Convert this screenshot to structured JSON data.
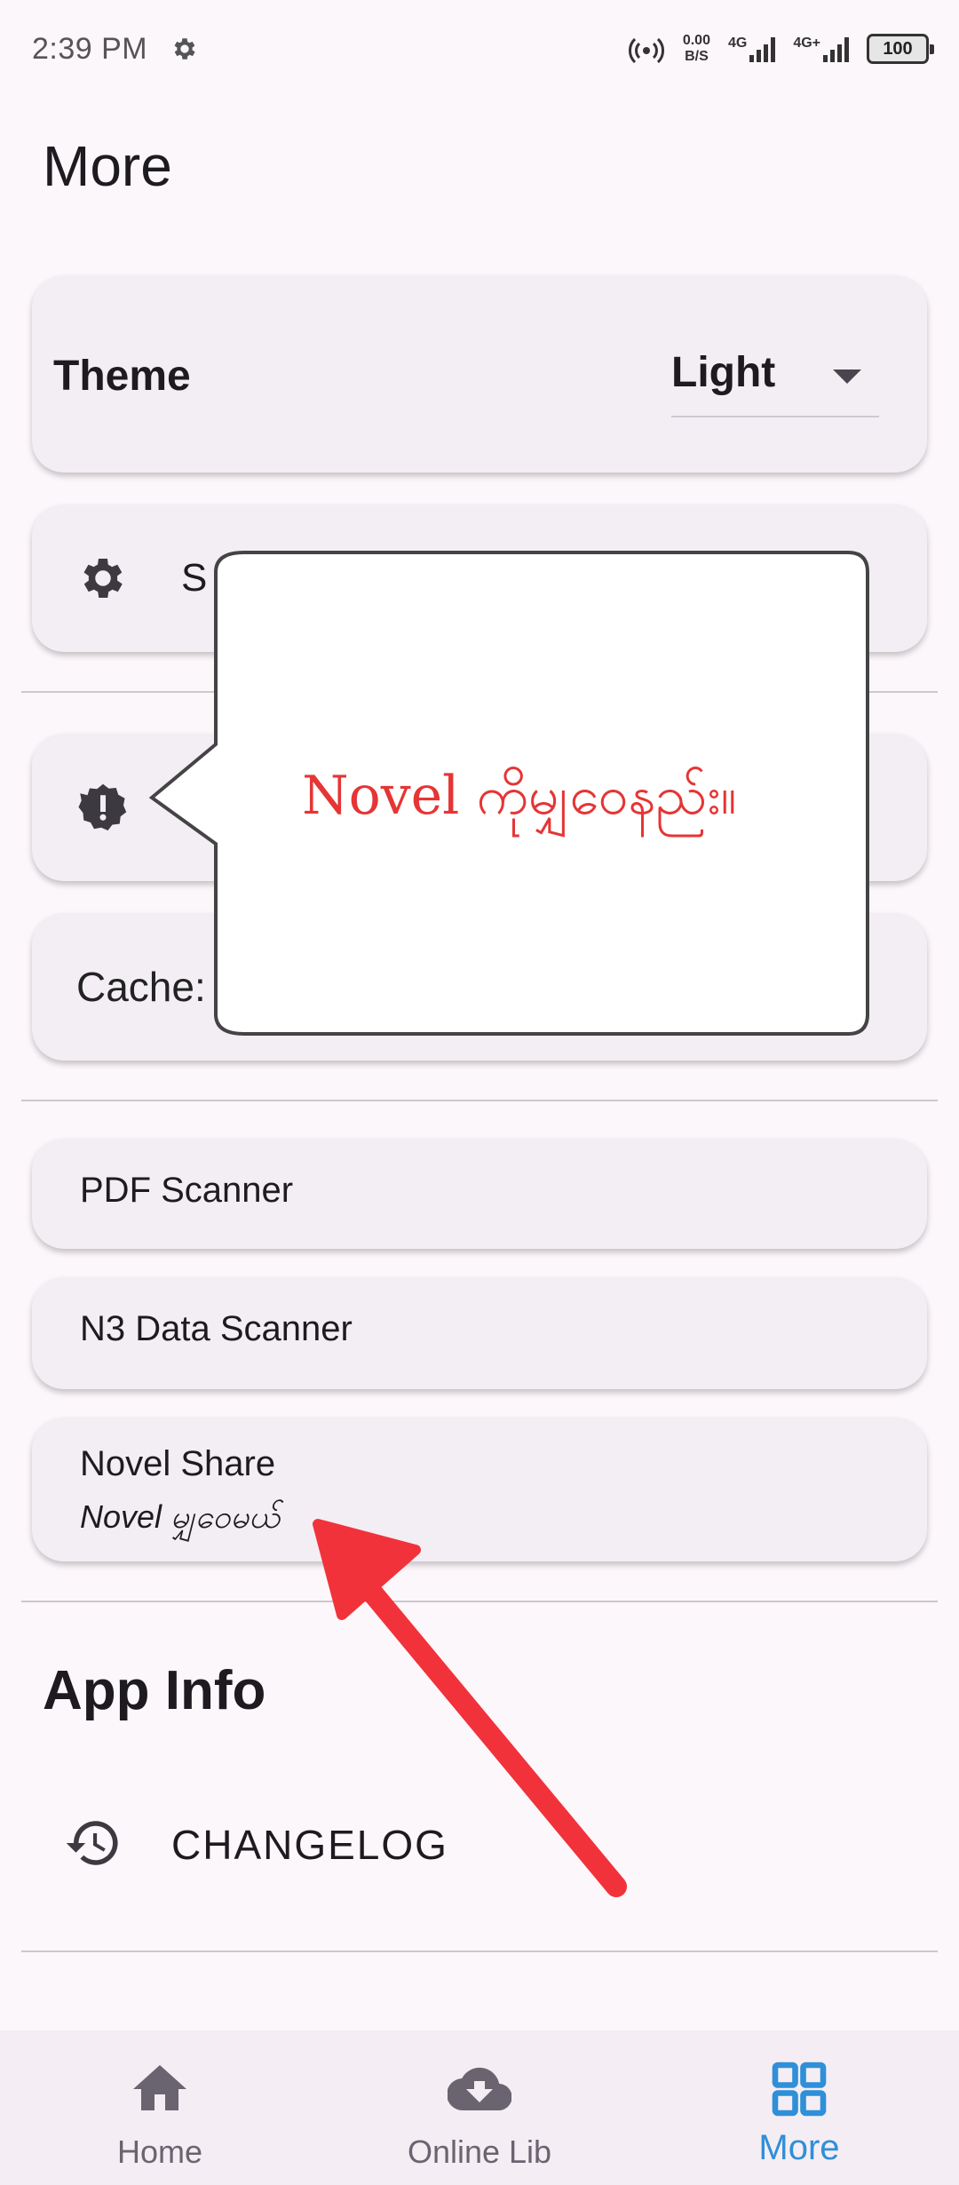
{
  "status_bar": {
    "time": "2:39 PM",
    "net_speed_value": "0.00",
    "net_speed_unit": "B/S",
    "sim1_label": "4G",
    "sim2_label": "4G+",
    "battery": "100"
  },
  "page": {
    "title": "More"
  },
  "theme": {
    "label": "Theme",
    "value": "Light"
  },
  "settings": {
    "label_partial": "S"
  },
  "cache": {
    "label_partial": "Cache:"
  },
  "tools": [
    {
      "title": "PDF Scanner"
    },
    {
      "title": "N3 Data Scanner"
    },
    {
      "title": "Novel Share",
      "subtitle": "Novel မျှဝေမယ်"
    }
  ],
  "app_info": {
    "title": "App Info",
    "changelog_label": "CHANGELOG"
  },
  "bottom_nav": [
    {
      "label": "Home",
      "icon": "home-icon"
    },
    {
      "label": "Online Lib",
      "icon": "cloud-download-icon"
    },
    {
      "label": "More",
      "icon": "grid-icon",
      "active": true
    }
  ],
  "popup": {
    "text": "Novel ကိုမျှဝေနည်း။"
  },
  "colors": {
    "accent": "#2f8fd8",
    "annotation": "#e53535",
    "background": "#fcf7fb"
  }
}
